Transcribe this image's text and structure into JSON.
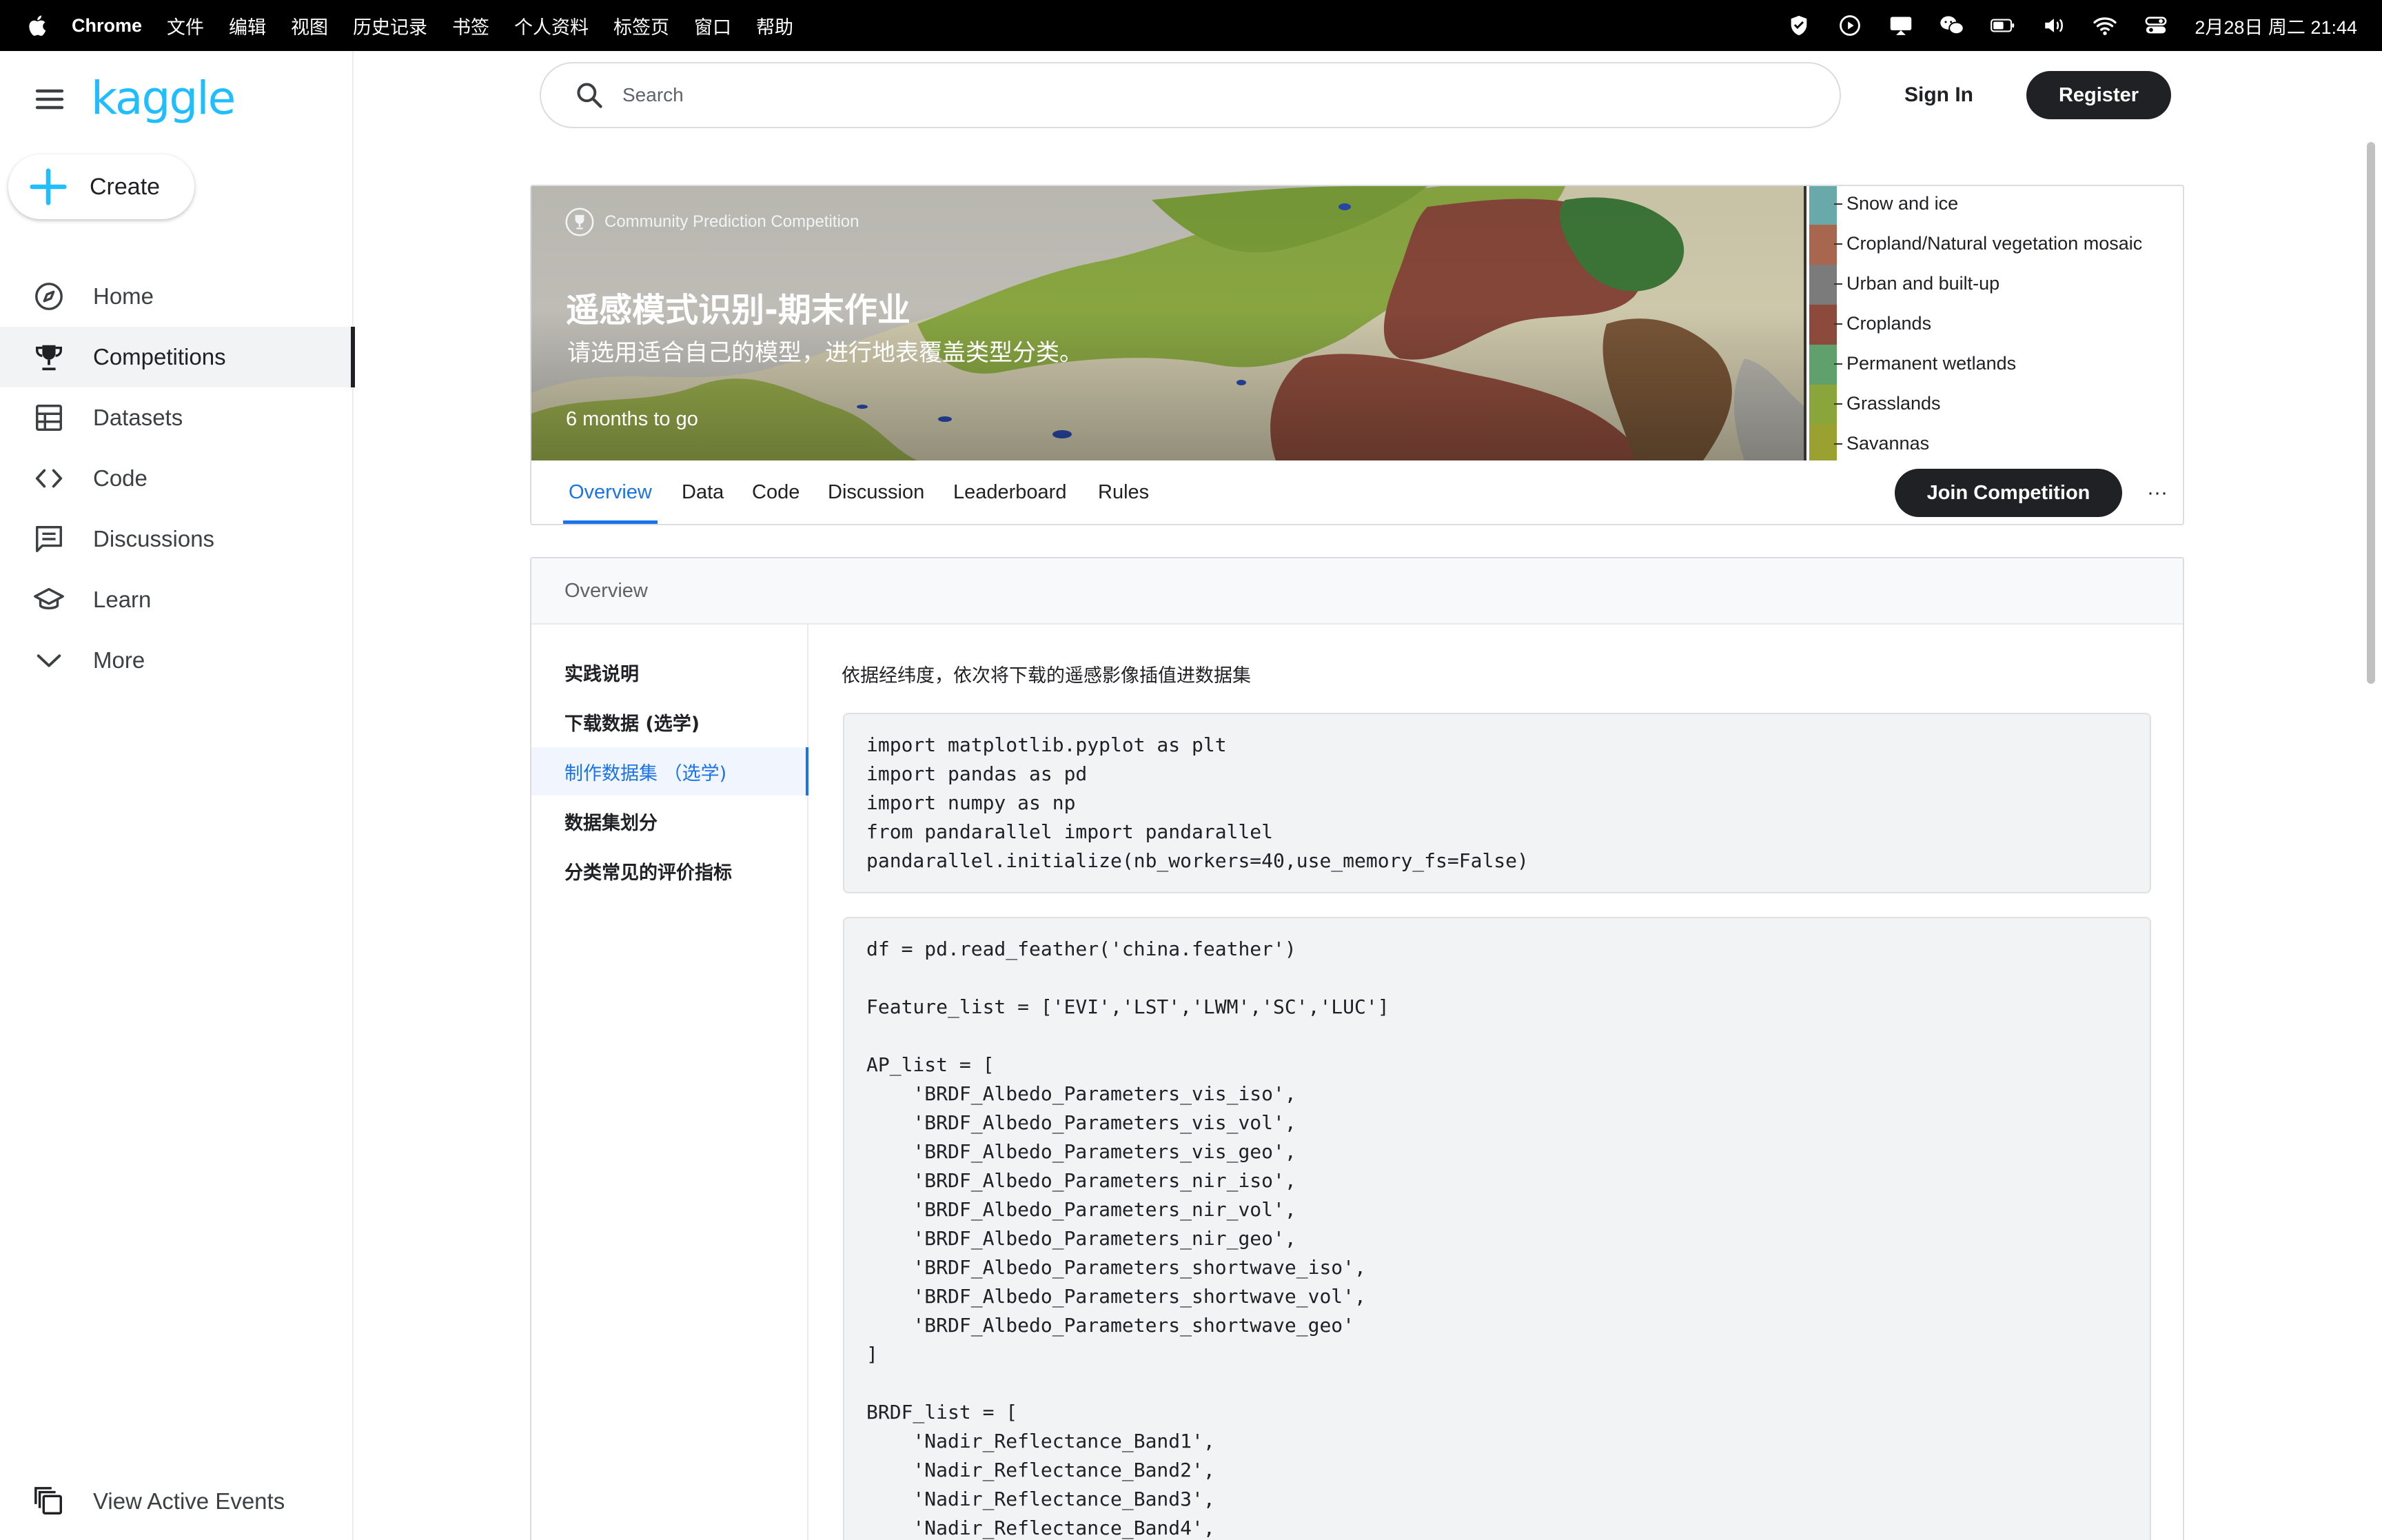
{
  "menubar": {
    "app_name": "Chrome",
    "items": [
      "文件",
      "编辑",
      "视图",
      "历史记录",
      "书签",
      "个人资料",
      "标签页",
      "窗口",
      "帮助"
    ],
    "clock": "2月28日 周二  21:44"
  },
  "sidebar": {
    "logo": "kaggle",
    "create_label": "Create",
    "items": [
      {
        "label": "Home",
        "icon": "compass-icon"
      },
      {
        "label": "Competitions",
        "icon": "trophy-icon"
      },
      {
        "label": "Datasets",
        "icon": "table-icon"
      },
      {
        "label": "Code",
        "icon": "code-icon"
      },
      {
        "label": "Discussions",
        "icon": "comments-icon"
      },
      {
        "label": "Learn",
        "icon": "school-icon"
      },
      {
        "label": "More",
        "icon": "chevron-down-icon"
      }
    ],
    "active_item": "Competitions",
    "footer_label": "View Active Events"
  },
  "topbar": {
    "search_placeholder": "Search",
    "signin_label": "Sign In",
    "register_label": "Register"
  },
  "competition": {
    "type_label": "Community Prediction Competition",
    "title": "遥感模式识别-期末作业",
    "subtitle": "请选用适合自己的模型，进行地表覆盖类型分类。",
    "deadline": "6 months to go",
    "legend": [
      {
        "label": "Snow and ice",
        "color": "#69a9a9"
      },
      {
        "label": "Cropland/Natural vegetation mosaic",
        "color": "#a8664f"
      },
      {
        "label": "Urban and built-up",
        "color": "#7b7b7b"
      },
      {
        "label": "Croplands",
        "color": "#8b4a3c"
      },
      {
        "label": "Permanent wetlands",
        "color": "#5fa06d"
      },
      {
        "label": "Grasslands",
        "color": "#8aa63a"
      },
      {
        "label": "Savannas",
        "color": "#9aa131"
      }
    ],
    "tabs": [
      "Overview",
      "Data",
      "Code",
      "Discussion",
      "Leaderboard",
      "Rules"
    ],
    "active_tab": "Overview",
    "join_label": "Join Competition",
    "more_label": "···"
  },
  "overview": {
    "header": "Overview",
    "toc": [
      "实践说明",
      "下载数据 (选学)",
      "制作数据集 （选学)",
      "数据集划分",
      "分类常见的评价指标"
    ],
    "active_toc": "制作数据集 （选学)",
    "intro": "依据经纬度，依次将下载的遥感影像插值进数据集",
    "code_blocks": [
      [
        "import matplotlib.pyplot as plt",
        "import pandas as pd",
        "import numpy as np",
        "from pandarallel import pandarallel",
        "pandarallel.initialize(nb_workers=40,use_memory_fs=False)"
      ],
      [
        "df = pd.read_feather('china.feather')",
        "",
        "Feature_list = ['EVI','LST','LWM','SC','LUC']",
        "",
        "AP_list = [",
        "    'BRDF_Albedo_Parameters_vis_iso',",
        "    'BRDF_Albedo_Parameters_vis_vol',",
        "    'BRDF_Albedo_Parameters_vis_geo',",
        "    'BRDF_Albedo_Parameters_nir_iso',",
        "    'BRDF_Albedo_Parameters_nir_vol',",
        "    'BRDF_Albedo_Parameters_nir_geo',",
        "    'BRDF_Albedo_Parameters_shortwave_iso',",
        "    'BRDF_Albedo_Parameters_shortwave_vol',",
        "    'BRDF_Albedo_Parameters_shortwave_geo'",
        "]",
        "",
        "BRDF_list = [",
        "    'Nadir_Reflectance_Band1',",
        "    'Nadir_Reflectance_Band2',",
        "    'Nadir_Reflectance_Band3',",
        "    'Nadir_Reflectance_Band4',"
      ]
    ]
  }
}
